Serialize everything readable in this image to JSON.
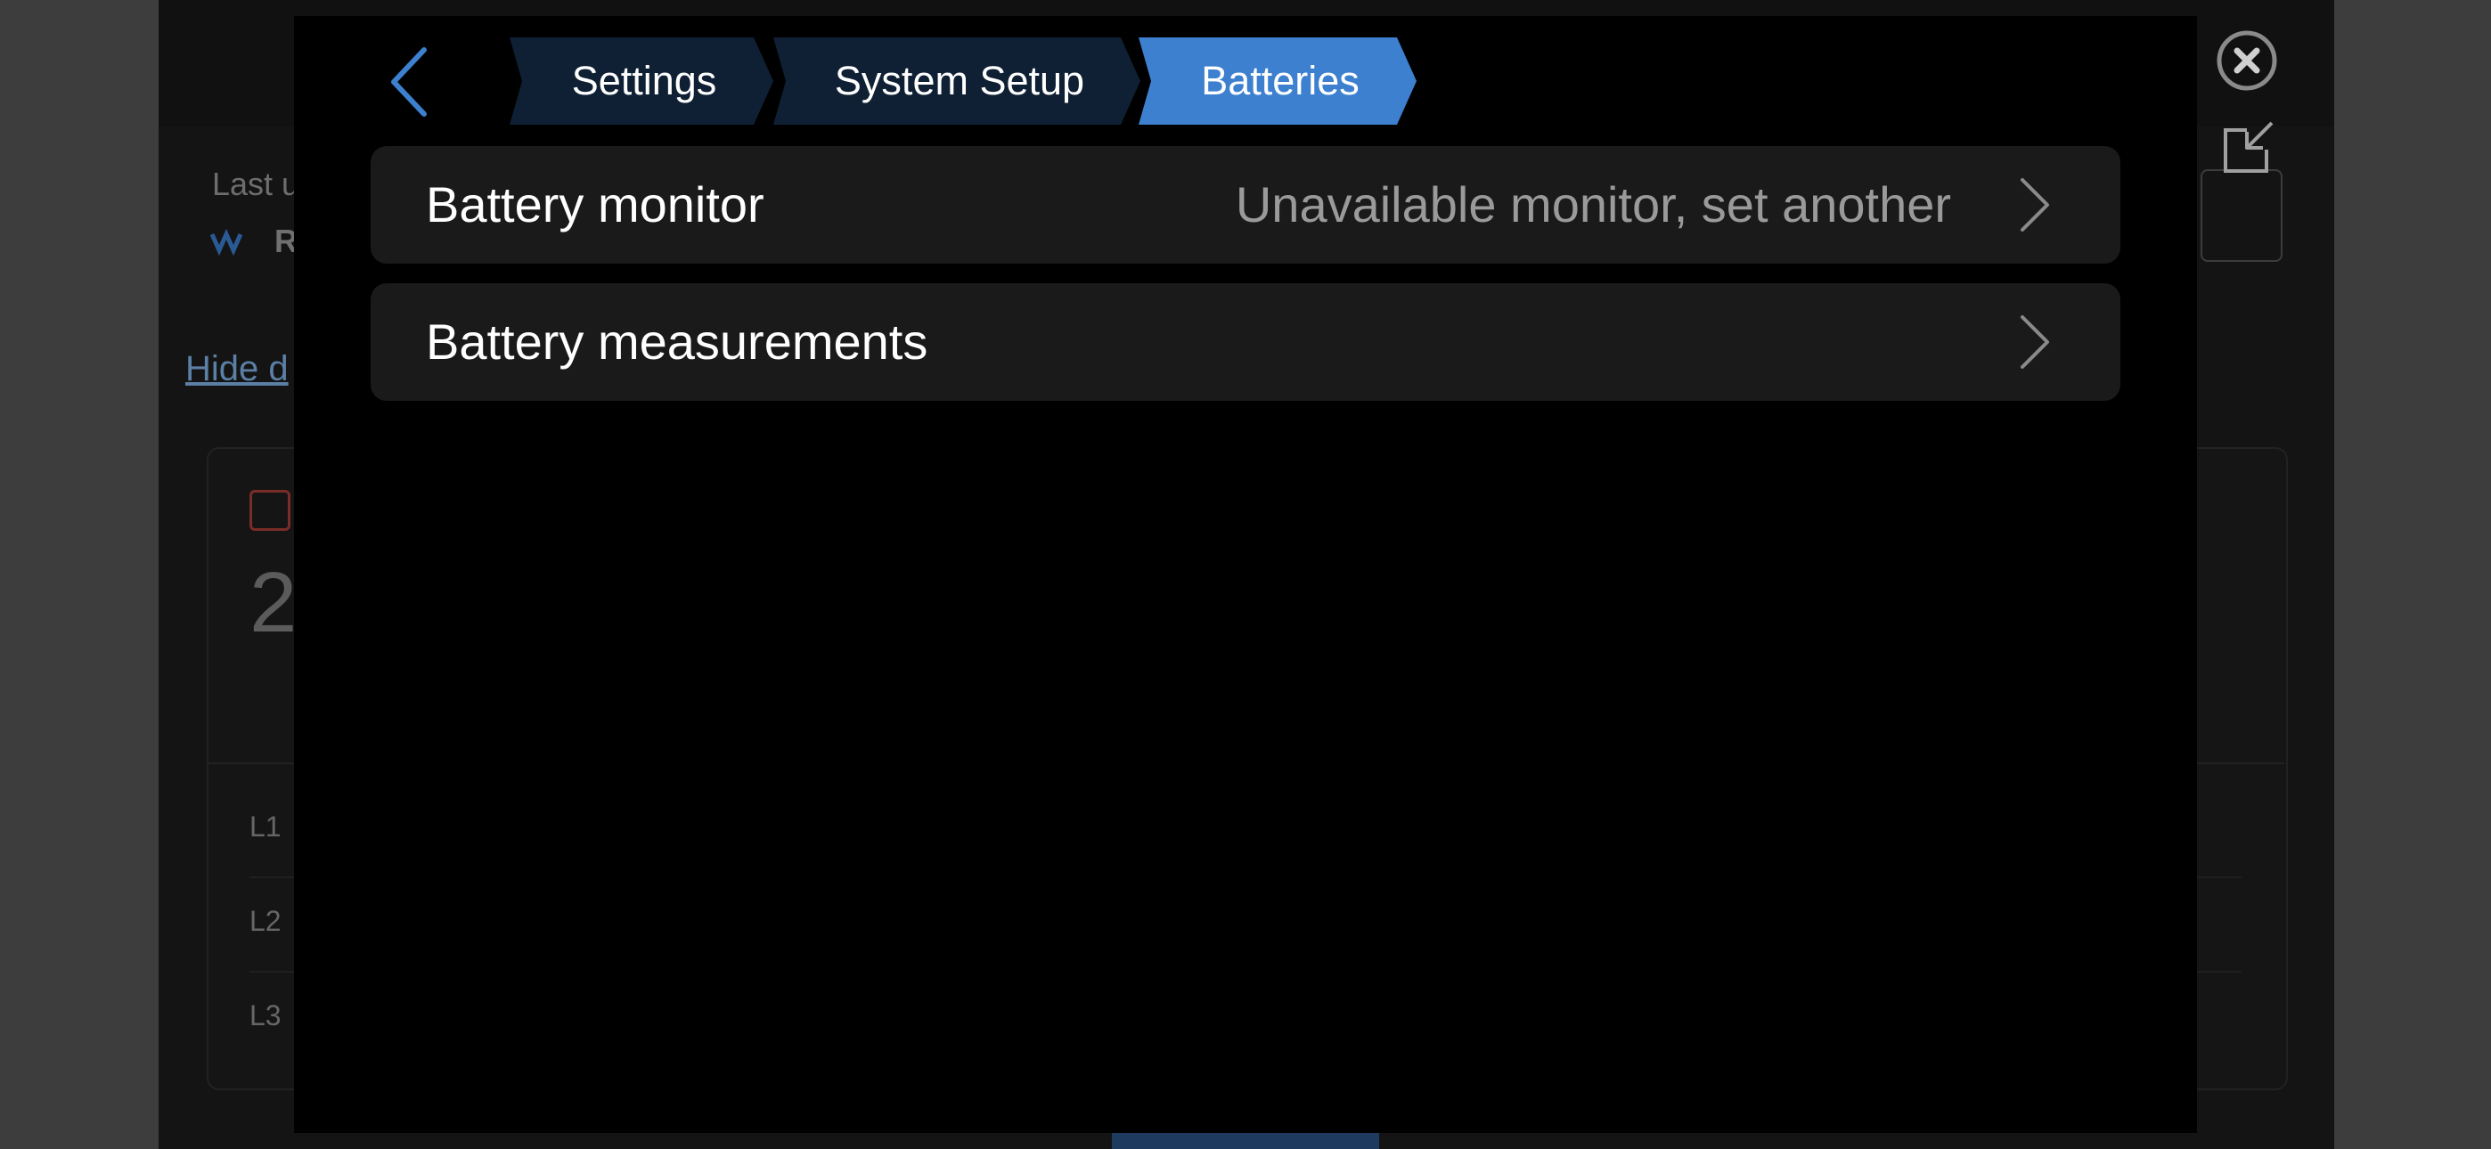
{
  "background": {
    "last_updated_partial": "Last u",
    "device_initial": "R",
    "hide_link_partial": "Hide d",
    "big_value_partial": "2",
    "phases": [
      "L1",
      "L2",
      "L3"
    ]
  },
  "breadcrumb": {
    "items": [
      {
        "label": "Settings"
      },
      {
        "label": "System Setup"
      },
      {
        "label": "Batteries"
      }
    ],
    "active_color": "#3c80cf",
    "inactive_color": "#0f2034"
  },
  "menu": {
    "items": [
      {
        "label": "Battery monitor",
        "value": "Unavailable monitor, set another"
      },
      {
        "label": "Battery measurements",
        "value": ""
      }
    ]
  },
  "icons": {
    "back": "chevron-left-icon",
    "row_arrow": "chevron-right-icon",
    "close": "close-icon",
    "collapse": "collapse-window-icon"
  }
}
